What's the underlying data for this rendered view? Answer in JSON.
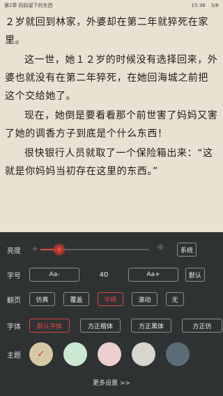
{
  "status": {
    "chapter": "第2章 妈妈留下的东西",
    "time": "15:36",
    "page": "3/6"
  },
  "content": {
    "paragraphs": [
      {
        "indent": false,
        "text": "２岁就回到林家，外婆却在第二年就猝死在家里。"
      },
      {
        "indent": true,
        "text": "这一世，她１２岁的时候没有选择回来，外婆也就没有在第二年猝死，在她回海城之前把这个交给她了。"
      },
      {
        "indent": true,
        "text": "现在，她倒是要看看那个前世害了妈妈又害了她的调香方子到底是个什么东西！"
      },
      {
        "indent": true,
        "text": "很快银行人员就取了一个保险箱出来：“这就是你妈妈当初存在这里的东西。”"
      }
    ]
  },
  "panel": {
    "brightness": {
      "label": "亮度",
      "level": 0.17,
      "system_label": "系统",
      "low_icon": "sun-small-icon",
      "high_icon": "sun-large-icon"
    },
    "font_size": {
      "label": "字号",
      "decrease_label": "Aa-",
      "value": "40",
      "increase_label": "Aa+",
      "default_label": "默认"
    },
    "page_turn": {
      "label": "翻页",
      "options": [
        "仿真",
        "覆盖",
        "平移",
        "滚动",
        "无"
      ],
      "selected": "平移"
    },
    "font": {
      "label": "字体",
      "options": [
        "默认字体",
        "方正楷体",
        "方正黑体",
        "方正仿"
      ],
      "selected": "默认字体"
    },
    "theme": {
      "label": "主题",
      "colors": [
        "#d8c9a6",
        "#cbe9d1",
        "#eccfcf",
        "#d7d5ce",
        "#5c6c77"
      ],
      "selected_index": 0
    },
    "more_label": "更多设置 >>"
  },
  "colors": {
    "background": "#e9e2d3",
    "panel": "#2f3233",
    "accent": "#e24a40"
  }
}
